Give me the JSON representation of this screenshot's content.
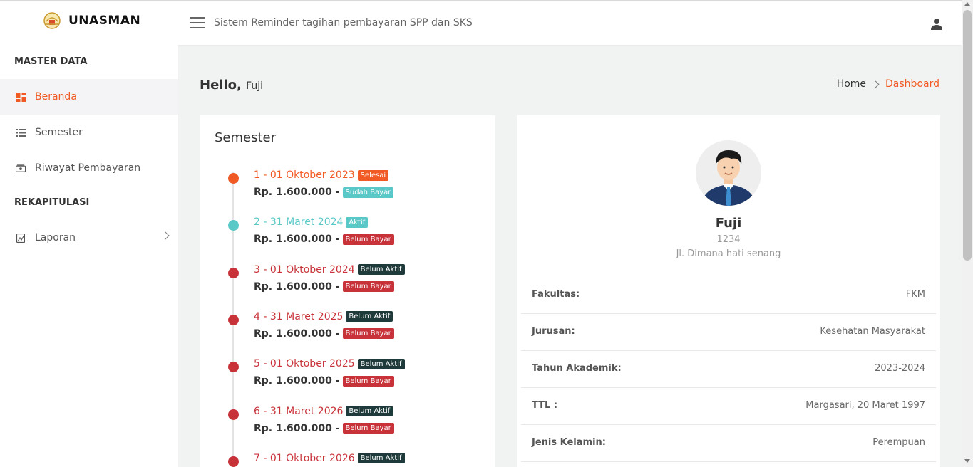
{
  "header": {
    "brand": "UNASMAN",
    "app_title": "Sistem Reminder tagihan pembayaran SPP dan SKS"
  },
  "sidebar": {
    "heading_master": "MASTER DATA",
    "items": [
      {
        "label": "Beranda",
        "icon": "dashboard-icon"
      },
      {
        "label": "Semester",
        "icon": "list-icon"
      },
      {
        "label": "Riwayat Pembayaran",
        "icon": "money-icon"
      }
    ],
    "heading_rekap": "REKAPITULASI",
    "laporan": {
      "label": "Laporan",
      "icon": "report-icon"
    }
  },
  "greeting": {
    "hello": "Hello,",
    "name": "Fuji"
  },
  "breadcrumb": {
    "home": "Home",
    "current": "Dashboard"
  },
  "semester_card": {
    "title": "Semester",
    "items": [
      {
        "label": "1 - 01 Oktober 2023",
        "status": "Selesai",
        "amount": "Rp. 1.600.000 -",
        "payment": "Sudah Bayar"
      },
      {
        "label": "2 - 31 Maret 2024",
        "status": "Aktif",
        "amount": "Rp. 1.600.000 -",
        "payment": "Belum Bayar"
      },
      {
        "label": "3 - 01 Oktober 2024",
        "status": "Belum Aktif",
        "amount": "Rp. 1.600.000 -",
        "payment": "Belum Bayar"
      },
      {
        "label": "4 - 31 Maret 2025",
        "status": "Belum Aktif",
        "amount": "Rp. 1.600.000 -",
        "payment": "Belum Bayar"
      },
      {
        "label": "5 - 01 Oktober 2025",
        "status": "Belum Aktif",
        "amount": "Rp. 1.600.000 -",
        "payment": "Belum Bayar"
      },
      {
        "label": "6 - 31 Maret 2026",
        "status": "Belum Aktif",
        "amount": "Rp. 1.600.000 -",
        "payment": "Belum Bayar"
      },
      {
        "label": "7 - 01 Oktober 2026",
        "status": "Belum Aktif",
        "amount": "",
        "payment": ""
      }
    ]
  },
  "profile": {
    "name": "Fuji",
    "nim": "1234",
    "address": "Jl. Dimana hati senang",
    "fields": [
      {
        "label": "Fakultas:",
        "value": "FKM"
      },
      {
        "label": "Jurusan:",
        "value": "Kesehatan Masyarakat"
      },
      {
        "label": "Tahun Akademik:",
        "value": "2023-2024"
      },
      {
        "label": "TTL :",
        "value": "Margasari, 20 Maret 1997"
      },
      {
        "label": "Jenis Kelamin:",
        "value": "Perempuan"
      }
    ]
  },
  "colors": {
    "accent": "#f15a24",
    "aktif": "#5bc8c8",
    "belum": "#c8333a",
    "dark_badge": "#1e3a3a",
    "sudah": "#5bc8c8"
  }
}
